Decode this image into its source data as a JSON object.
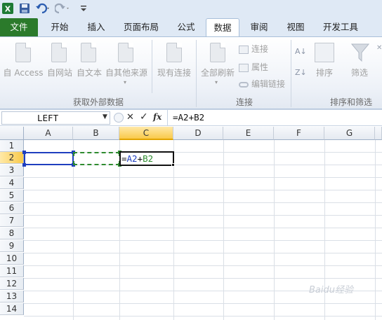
{
  "titlebar": {
    "app_icon": "excel-icon",
    "tools": [
      "save-icon",
      "undo-icon",
      "redo-icon",
      "customize-icon"
    ]
  },
  "tabs": [
    "文件",
    "开始",
    "插入",
    "页面布局",
    "公式",
    "数据",
    "审阅",
    "视图",
    "开发工具"
  ],
  "active_tab": "数据",
  "ribbon": {
    "groups": [
      {
        "label": "获取外部数据",
        "buttons": [
          "自 Access",
          "自网站",
          "自文本",
          "自其他来源",
          "现有连接"
        ]
      },
      {
        "label": "连接",
        "buttons": [
          "全部刷新",
          "连接",
          "属性",
          "编辑链接"
        ]
      },
      {
        "label": "排序和筛选",
        "buttons": [
          "排序",
          "筛选"
        ]
      }
    ]
  },
  "formula_bar": {
    "name_box": "LEFT",
    "fx_label": "fx",
    "content": "=A2+B2"
  },
  "sheet": {
    "columns": [
      "A",
      "B",
      "C",
      "D",
      "E",
      "F",
      "G"
    ],
    "rows": [
      "1",
      "2",
      "3",
      "4",
      "5",
      "6",
      "7",
      "8",
      "9",
      "10",
      "11",
      "12",
      "13",
      "14"
    ],
    "selected_column": "C",
    "selected_row": "2",
    "active_cell_text": {
      "prefix": "=",
      "ref1": "A2",
      "op": "+",
      "ref2": "B2"
    },
    "colors": {
      "ref1": "#1f3fbf",
      "ref2": "#2e8b2e",
      "header_highlight": "#f9c94a"
    }
  },
  "watermark": "Baidu经验"
}
